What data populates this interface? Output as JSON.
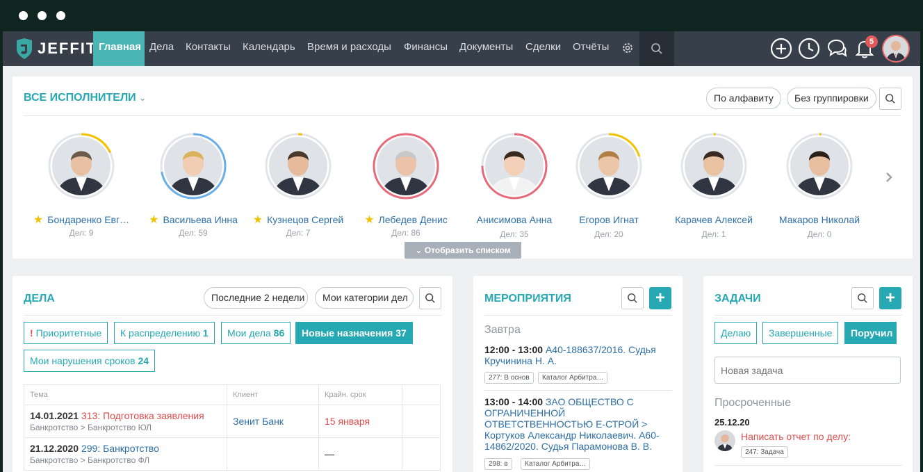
{
  "window": {
    "dots": 3
  },
  "nav": {
    "logo": "JEFFIT",
    "items": [
      {
        "label": "Главная",
        "active": true
      },
      {
        "label": "Дела"
      },
      {
        "label": "Контакты"
      },
      {
        "label": "Календарь"
      },
      {
        "label": "Время и расходы"
      },
      {
        "label": "Финансы"
      },
      {
        "label": "Документы"
      },
      {
        "label": "Сделки"
      },
      {
        "label": "Отчёты"
      }
    ],
    "icons": [
      "gear-icon",
      "search-icon",
      "plus-circle-icon",
      "clock-icon",
      "chat-icon",
      "bell-icon"
    ],
    "notifications": "5",
    "accent": "#49b5b5"
  },
  "performers": {
    "title": "ВСЕ ИСПОЛНИТЕЛИ",
    "sort_label": "По алфавиту",
    "group_label": "Без группировки",
    "toggle_label": "Отобразить списком",
    "items": [
      {
        "name": "Бондаренко Евг…",
        "count": "Дел: 9",
        "star": true,
        "progress": 0.18,
        "ring_color": "#f2c200"
      },
      {
        "name": "Васильева Инна",
        "count": "Дел: 59",
        "star": true,
        "progress": 0.72,
        "ring_color": "#6aaee8"
      },
      {
        "name": "Кузнецов Сергей",
        "count": "Дел: 7",
        "star": true,
        "progress": 0.02,
        "ring_color": "#f2c200"
      },
      {
        "name": "Лебедев Денис",
        "count": "Дел: 86",
        "star": true,
        "progress": 1.0,
        "ring_color": "#e66a7a"
      },
      {
        "name": "Анисимова Анна",
        "count": "Дел: 35",
        "star": false,
        "progress": 0.75,
        "ring_color": "#e66a7a"
      },
      {
        "name": "Егоров Игнат",
        "count": "Дел: 20",
        "star": false,
        "progress": 0.2,
        "ring_color": "#f2c200"
      },
      {
        "name": "Карачев Алексей",
        "count": "Дел: 1",
        "star": false,
        "progress": 0.01,
        "ring_color": "#f2c200"
      },
      {
        "name": "Макаров Николай",
        "count": "Дел: 0",
        "star": false,
        "progress": 0.01,
        "ring_color": "#f2c200"
      }
    ]
  },
  "deals": {
    "title": "ДЕЛА",
    "period": "Последние 2 недели",
    "categories": "Мои категории дел",
    "filters": [
      {
        "label": "Приоритетные",
        "count": "",
        "priority": true
      },
      {
        "label": "К распределению",
        "count": "1"
      },
      {
        "label": "Мои дела",
        "count": "86"
      },
      {
        "label": "Новые назначения",
        "count": "37",
        "active": true
      },
      {
        "label": "Мои нарушения сроков",
        "count": "24"
      }
    ],
    "columns": [
      "Тема",
      "Клиент",
      "Крайн. срок",
      ""
    ],
    "rows": [
      {
        "date": "14.01.2021",
        "title": "313: Подготовка заявления",
        "path": "Банкротство > Банкротство ЮЛ",
        "client": "Зенит Банк",
        "deadline": "15 января",
        "overdue": true
      },
      {
        "date": "21.12.2020",
        "title": "299: Банкротство",
        "path": "Банкротство > Банкротство ФЛ",
        "client": "",
        "deadline": "—",
        "overdue": false
      }
    ]
  },
  "events": {
    "title": "МЕРОПРИЯТИЯ",
    "group": "Завтра",
    "items": [
      {
        "time": "12:00 - 13:00",
        "text": "А40-188637/2016. Судья Кручинина Н. А.",
        "tags": [
          "277: В основ",
          "Каталог Арбитра…"
        ]
      },
      {
        "time": "13:00 - 14:00",
        "text": "ЗАО ОБЩЕСТВО С ОГРАНИЧЕННОЙ ОТВЕТСТВЕННОСТЬЮ Е-СТРОЙ > Кортуков Александр Николаевич. А60-14862/2020. Судья Парамонова В. В.",
        "tags": [
          "298: в",
          "Каталог Арбитра…"
        ]
      }
    ]
  },
  "tasks": {
    "title": "ЗАДАЧИ",
    "tabs": [
      {
        "label": "Делаю"
      },
      {
        "label": "Завершенные"
      },
      {
        "label": "Поручил",
        "active": true
      }
    ],
    "new_placeholder": "Новая задача",
    "overdue_label": "Просроченные",
    "items": [
      {
        "date": "25.12.20",
        "text": "Написать отчет по делу:",
        "tag": "247: Задача"
      }
    ]
  }
}
